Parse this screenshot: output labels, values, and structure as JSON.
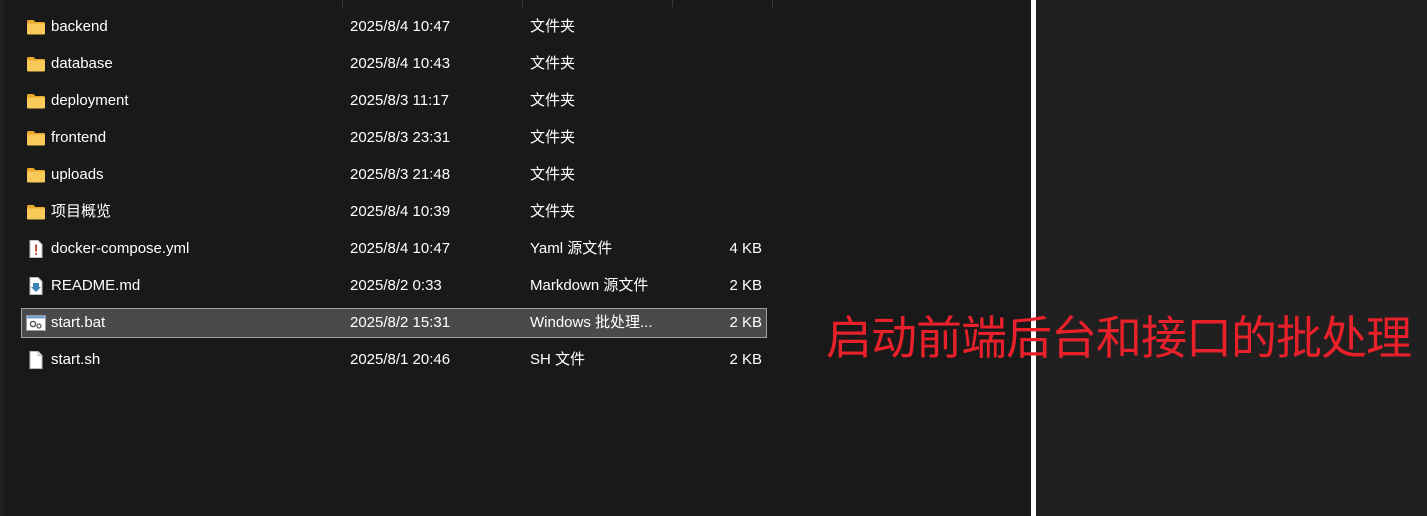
{
  "files": [
    {
      "name": "backend",
      "date": "2025/8/4 10:47",
      "type": "文件夹",
      "size": "",
      "icon": "folder-icon"
    },
    {
      "name": "database",
      "date": "2025/8/4 10:43",
      "type": "文件夹",
      "size": "",
      "icon": "folder-icon"
    },
    {
      "name": "deployment",
      "date": "2025/8/3 11:17",
      "type": "文件夹",
      "size": "",
      "icon": "folder-icon"
    },
    {
      "name": "frontend",
      "date": "2025/8/3 23:31",
      "type": "文件夹",
      "size": "",
      "icon": "folder-icon"
    },
    {
      "name": "uploads",
      "date": "2025/8/3 21:48",
      "type": "文件夹",
      "size": "",
      "icon": "folder-icon"
    },
    {
      "name": "项目概览",
      "date": "2025/8/4 10:39",
      "type": "文件夹",
      "size": "",
      "icon": "folder-icon"
    },
    {
      "name": "docker-compose.yml",
      "date": "2025/8/4 10:47",
      "type": "Yaml 源文件",
      "size": "4 KB",
      "icon": "yaml-file-icon"
    },
    {
      "name": "README.md",
      "date": "2025/8/2 0:33",
      "type": "Markdown 源文件",
      "size": "2 KB",
      "icon": "markdown-file-icon"
    },
    {
      "name": "start.bat",
      "date": "2025/8/2 15:31",
      "type": "Windows 批处理...",
      "size": "2 KB",
      "icon": "batch-file-icon",
      "selected": true
    },
    {
      "name": "start.sh",
      "date": "2025/8/1 20:46",
      "type": "SH 文件",
      "size": "2 KB",
      "icon": "file-icon"
    }
  ],
  "annotation": "启动前端后台和接口的批处理",
  "colors": {
    "background": "#191919",
    "selection": "#4a4a4a",
    "annotation": "#e8202a",
    "folder": "#f4c04e"
  }
}
